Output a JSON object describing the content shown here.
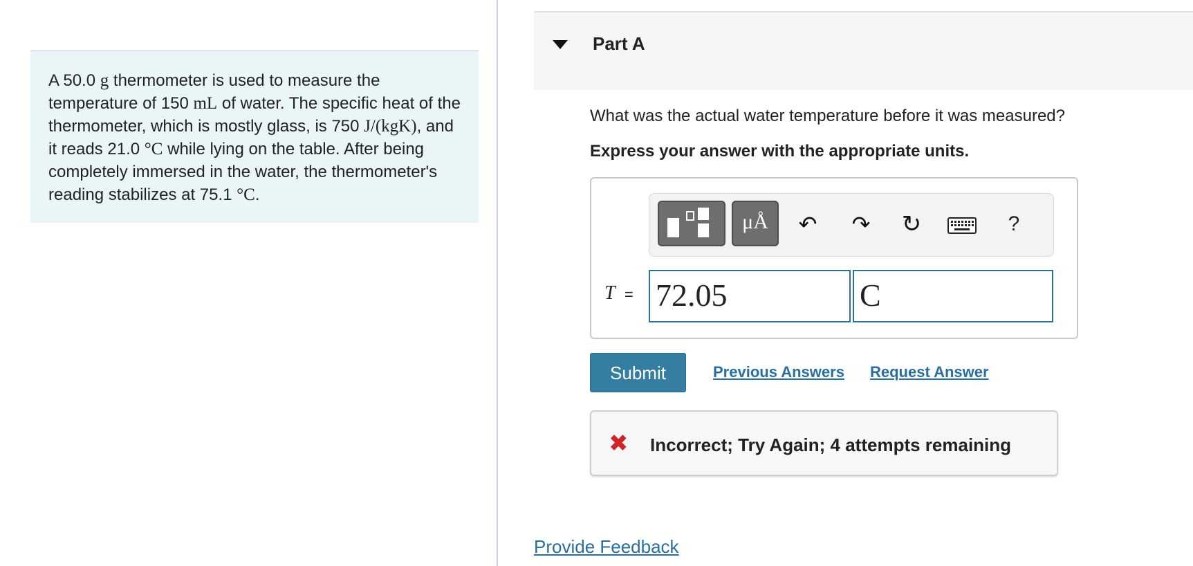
{
  "problem": {
    "segments": [
      {
        "text": "A 50.0 ",
        "math": false
      },
      {
        "text": "g",
        "math": true
      },
      {
        "text": " thermometer is used to measure the temperature of 150 ",
        "math": false
      },
      {
        "text": "mL",
        "math": true
      },
      {
        "text": " of water. The specific heat of the thermometer, which is mostly glass, is 750 ",
        "math": false
      },
      {
        "text": "J/(kgK)",
        "math": true
      },
      {
        "text": ", and it reads 21.0 ",
        "math": false
      },
      {
        "text": "°C",
        "math": true
      },
      {
        "text": " while lying on the table. After being completely immersed in the water, the thermometer's reading stabilizes at 75.1 ",
        "math": false
      },
      {
        "text": "°C",
        "math": true
      },
      {
        "text": ".",
        "math": false
      }
    ]
  },
  "part": {
    "title": "Part A",
    "question": "What was the actual water temperature before it was measured?",
    "instruction": "Express your answer with the appropriate units."
  },
  "toolbar": {
    "units_symbol": "μÅ",
    "help_label": "?",
    "icons": [
      "templates-icon",
      "units-icon",
      "undo-icon",
      "redo-icon",
      "reset-icon",
      "keyboard-icon",
      "help-icon"
    ]
  },
  "answer": {
    "variable": "T",
    "equals": "=",
    "value": "72.05",
    "unit": "C"
  },
  "actions": {
    "submit_label": "Submit",
    "previous_answers_label": "Previous Answers",
    "request_answer_label": "Request Answer"
  },
  "feedback": {
    "message": "Incorrect; Try Again; 4 attempts remaining",
    "status": "incorrect"
  },
  "footer": {
    "provide_feedback_label": "Provide Feedback"
  },
  "colors": {
    "problem_bg": "#eaf5f7",
    "primary_button": "#337ea1",
    "link": "#2a6ea0",
    "field_border": "#2b7099",
    "error": "#d0242b"
  }
}
